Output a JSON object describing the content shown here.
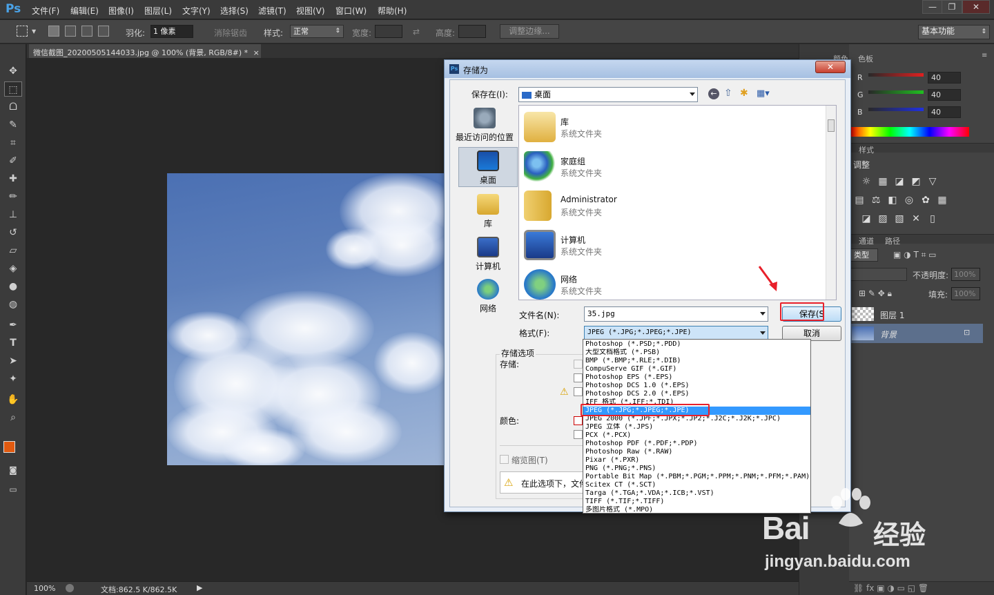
{
  "app": {
    "logo": "Ps",
    "menu": [
      "文件(F)",
      "编辑(E)",
      "图像(I)",
      "图层(L)",
      "文字(Y)",
      "选择(S)",
      "滤镜(T)",
      "视图(V)",
      "窗口(W)",
      "帮助(H)"
    ],
    "window_controls": [
      "—",
      "❐",
      "✕"
    ]
  },
  "options_bar": {
    "feather_label": "羽化:",
    "feather_value": "1 像素",
    "antialias_label": "消除锯齿",
    "style_label": "样式:",
    "style_value": "正常",
    "width_label": "宽度:",
    "height_label": "高度:",
    "refine_edge_label": "调整边缘...",
    "workspace_value": "基本功能"
  },
  "document": {
    "tab_title": "微信截图_20200505144033.jpg @ 100% (背景, RGB/8#) *",
    "tab_close": "×"
  },
  "status_bar": {
    "zoom": "100%",
    "doc_info": "文档:862.5 K/862.5K"
  },
  "panels": {
    "color_tabs": [
      "颜色",
      "色板"
    ],
    "rgb": [
      {
        "label": "R",
        "value": "40"
      },
      {
        "label": "G",
        "value": "40"
      },
      {
        "label": "B",
        "value": "40"
      }
    ],
    "styles_tab": "样式",
    "adjust_title": "调整",
    "layer_tabs": [
      "通道",
      "路径"
    ],
    "kind_label": "类型",
    "opacity_label": "不透明度:",
    "opacity_value": "100%",
    "fill_label": "填充:",
    "fill_value": "100%",
    "layers": [
      {
        "name": "图层 1"
      },
      {
        "name": "背景"
      }
    ]
  },
  "dialog": {
    "title": "存储为",
    "close": "✕",
    "save_in_label": "保存在(I):",
    "save_in_value": "桌面",
    "places": [
      {
        "label": "最近访问的位置"
      },
      {
        "label": "桌面"
      },
      {
        "label": "库"
      },
      {
        "label": "计算机"
      },
      {
        "label": "网络"
      }
    ],
    "files": [
      {
        "name": "库",
        "type": "系统文件夹"
      },
      {
        "name": "家庭组",
        "type": "系统文件夹"
      },
      {
        "name": "Administrator",
        "type": "系统文件夹"
      },
      {
        "name": "计算机",
        "type": "系统文件夹"
      },
      {
        "name": "网络",
        "type": "系统文件夹"
      }
    ],
    "filename_label": "文件名(N):",
    "filename_value": "35.jpg",
    "format_label": "格式(F):",
    "format_value": "JPEG (*.JPG;*.JPEG;*.JPE)",
    "save_button": "保存(S",
    "cancel_button": "取消",
    "storage_options_label": "存储选项",
    "storage_label": "存储:",
    "color_label": "颜色:",
    "thumbnail_label": "缩览图(T)",
    "warning_text": "在此选项下，文件"
  },
  "format_options": [
    "Photoshop (*.PSD;*.PDD)",
    "大型文档格式 (*.PSB)",
    "BMP (*.BMP;*.RLE;*.DIB)",
    "CompuServe GIF (*.GIF)",
    "Photoshop EPS (*.EPS)",
    "Photoshop DCS 1.0 (*.EPS)",
    "Photoshop DCS 2.0 (*.EPS)",
    "IFF 格式 (*.IFF;*.TDI)",
    "JPEG (*.JPG;*.JPEG;*.JPE)",
    "JPEG 2000 (*.JPF;*.JPX;*.JP2;*.J2C;*.J2K;*.JPC)",
    "JPEG 立体 (*.JPS)",
    "PCX (*.PCX)",
    "Photoshop PDF (*.PDF;*.PDP)",
    "Photoshop Raw (*.RAW)",
    "Pixar (*.PXR)",
    "PNG (*.PNG;*.PNS)",
    "Portable Bit Map (*.PBM;*.PGM;*.PPM;*.PNM;*.PFM;*.PAM)",
    "Scitex CT (*.SCT)",
    "Targa (*.TGA;*.VDA;*.ICB;*.VST)",
    "TIFF (*.TIF;*.TIFF)",
    "多图片格式 (*.MPO)"
  ],
  "selected_format_index": 8,
  "watermark": {
    "brand": "Bai",
    "brand_suffix": "经验",
    "url": "jingyan.baidu.com"
  }
}
